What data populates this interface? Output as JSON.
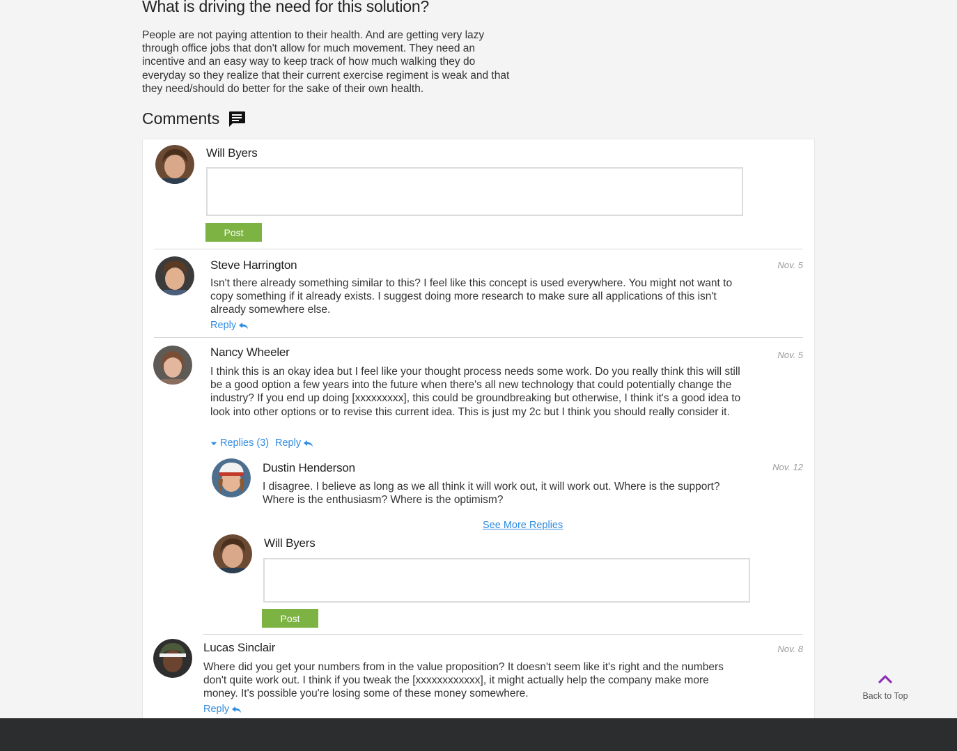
{
  "section": {
    "title": "What is driving the need for this solution?",
    "body": "People are not paying attention to their health. And are getting very lazy through office jobs that don't allow for much movement. They need an incentive and an easy way to keep track of how much walking they do everyday so they realize that their current exercise regiment is weak and that they need/should do better for the sake of their own health."
  },
  "comments": {
    "heading": "Comments",
    "heading_icon": "chat-bubble-icon",
    "composer": {
      "user": "Will Byers",
      "post_label": "Post"
    },
    "items": [
      {
        "author": "Steve Harrington",
        "date": "Nov. 5",
        "text": "Isn't there already something similar to this? I feel like this concept is used everywhere. You might not want to copy something if it already exists. I suggest doing more research to make sure all applications of this isn't already somewhere else.",
        "reply_label": "Reply"
      },
      {
        "author": "Nancy Wheeler",
        "date": "Nov. 5",
        "text": "I think this is an okay idea but I feel like your thought process needs some work. Do you really think this will still be a good option a few years into the future when there's all new technology that could potentially change the industry? If you end up doing [xxxxxxxxx], this could be groundbreaking but otherwise, I think it's a good idea to look into other options or to revise this current idea. This is just my 2c but I think you should really consider it.",
        "replies_label": "Replies (3)",
        "reply_label": "Reply",
        "replies": [
          {
            "author": "Dustin Henderson",
            "date": "Nov. 12",
            "text": "I disagree. I believe as long as we all think it will work out, it will work out. Where is the support? Where is the enthusiasm? Where is the optimism?"
          }
        ],
        "see_more_label": "See More Replies",
        "reply_composer": {
          "user": "Will Byers",
          "post_label": "Post"
        }
      },
      {
        "author": "Lucas Sinclair",
        "date": "Nov. 8",
        "text": "Where did you get your numbers from in the value proposition? It doesn't seem like it's right and the numbers don't quite work out. I think if you tweak the [xxxxxxxxxxxx], it might actually help the company make more money. It's possible you're losing some of these money somewhere.",
        "reply_label": "Reply"
      }
    ]
  },
  "back_to_top": {
    "label": "Back to Top",
    "icon": "chevron-up-icon"
  },
  "colors": {
    "accent": "#7cb342",
    "link": "#2f8be0",
    "back_to_top": "#8e2fb5",
    "footer": "#2c2d2f"
  }
}
